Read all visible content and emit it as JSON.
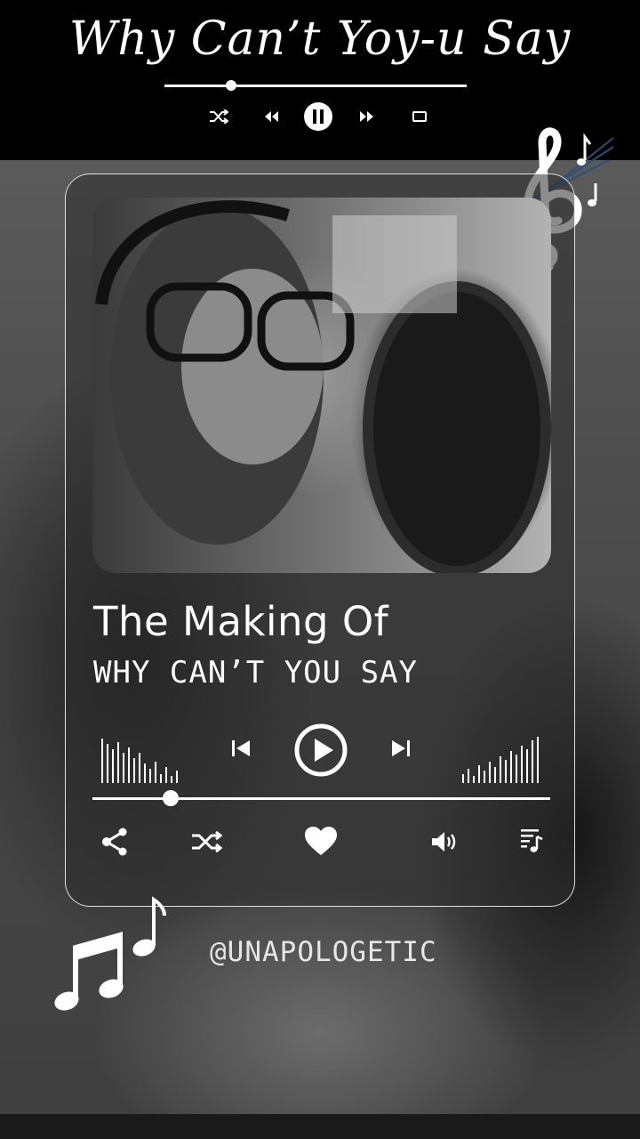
{
  "banner": {
    "title": "Why Can’t Yoy-u Say",
    "progress": 0.22,
    "controls": [
      "shuffle-icon",
      "rewind-icon",
      "pause-icon",
      "fast-forward-icon",
      "repeat-icon"
    ]
  },
  "player": {
    "title": "The Making Of",
    "subtitle": "WHY CAN’T YOU SAY",
    "progress": 0.17,
    "controls": [
      "skip-previous-icon",
      "play-icon",
      "skip-next-icon"
    ],
    "actions": [
      "share-icon",
      "shuffle-icon",
      "heart-icon",
      "volume-icon",
      "playlist-icon"
    ]
  },
  "handle": "@UNAPOLOGETIC",
  "colors": {
    "banner_bg": "#000000",
    "foreground": "#ffffff",
    "card_bg": "#2d2d2d"
  }
}
